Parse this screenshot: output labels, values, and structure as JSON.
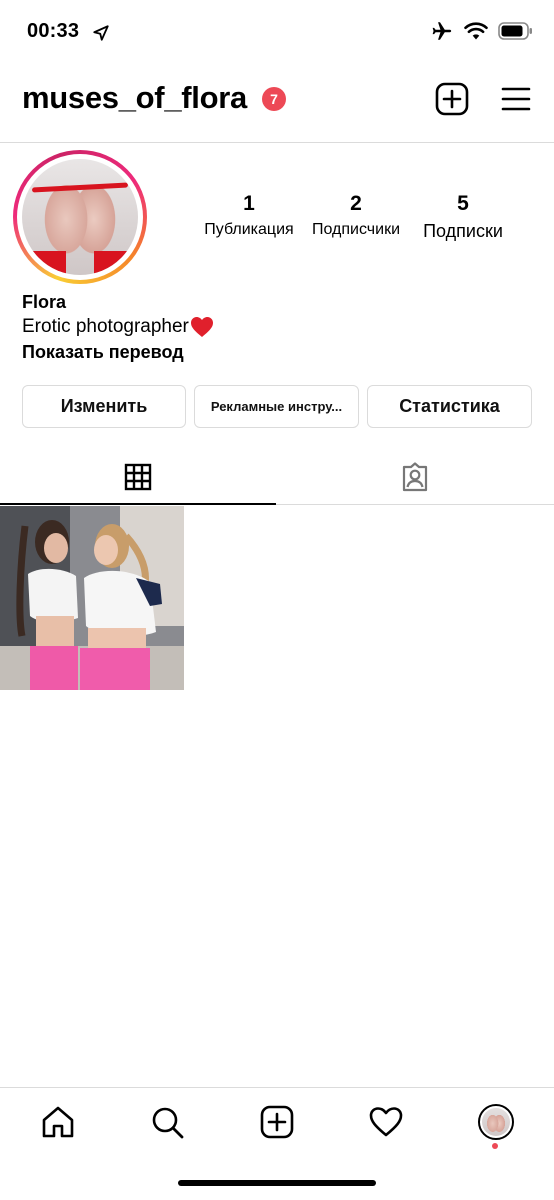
{
  "status_bar": {
    "time": "00:33",
    "icons": [
      "location-arrow-icon",
      "airplane-icon",
      "wifi-icon",
      "battery-icon"
    ]
  },
  "header": {
    "username": "muses_of_flora",
    "notification_count": "7",
    "icons": [
      "new-post-icon",
      "menu-icon"
    ]
  },
  "profile": {
    "stats": [
      {
        "value": "1",
        "label": "Публикация"
      },
      {
        "value": "2",
        "label": "Подписчики"
      },
      {
        "value": "5",
        "label": "Подписки"
      }
    ],
    "name": "Flora",
    "bio": "Erotic photographer",
    "bio_emoji": "❤️",
    "translate_label": "Показать перевод"
  },
  "buttons": {
    "edit": "Изменить",
    "promo_tools": "Рекламные инстру...",
    "insights": "Статистика"
  },
  "tabs": {
    "active": "grid",
    "icons": [
      "grid-icon",
      "tagged-icon"
    ]
  },
  "colors": {
    "badge": "#ed4956",
    "divider": "#dbdbdb"
  },
  "bottom_nav": {
    "icons": [
      "home-icon",
      "search-icon",
      "create-icon",
      "activity-heart-icon",
      "profile-avatar"
    ]
  }
}
